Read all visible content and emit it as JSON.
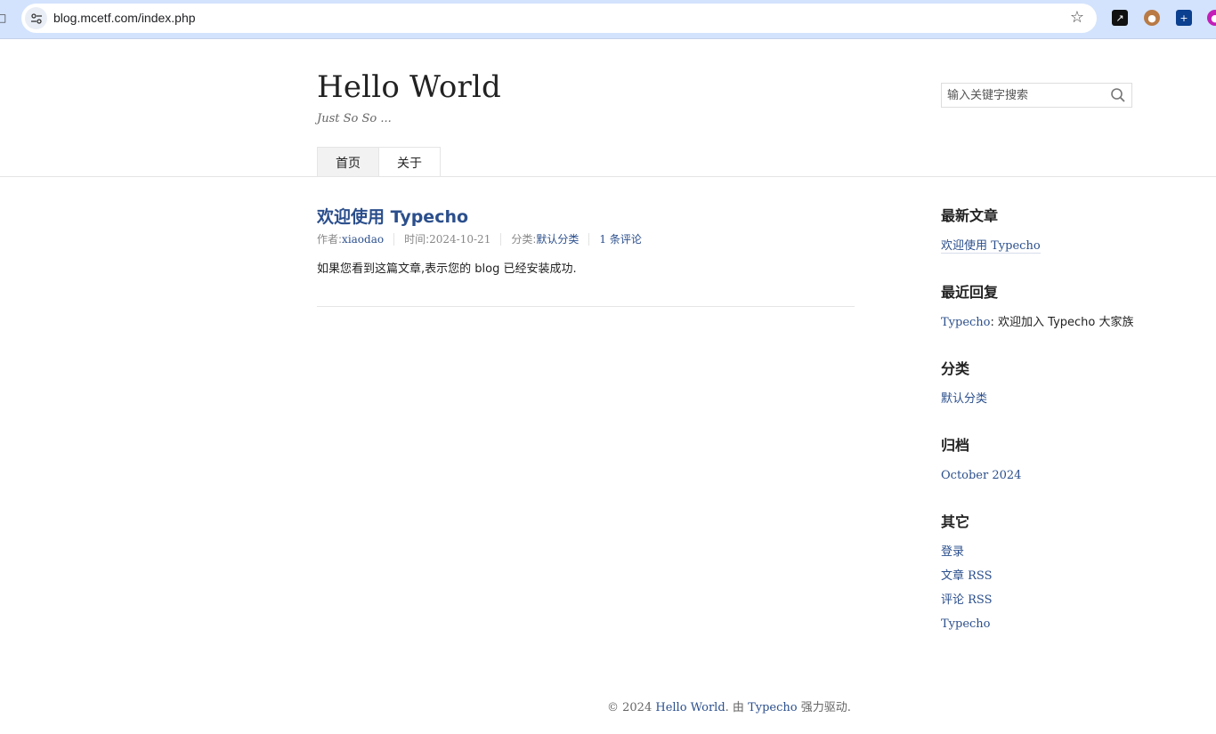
{
  "browser": {
    "url": "blog.mcetf.com/index.php"
  },
  "header": {
    "title": "Hello World",
    "description": "Just So So ...",
    "search_placeholder": "输入关键字搜索"
  },
  "nav": {
    "items": [
      {
        "label": "首页"
      },
      {
        "label": "关于"
      }
    ]
  },
  "post": {
    "title": "欢迎使用 Typecho",
    "author_label": "作者: ",
    "author": "xiaodao",
    "date_label": "时间: ",
    "date": "2024-10-21",
    "category_label": "分类: ",
    "category": "默认分类",
    "comments": "1 条评论",
    "body": "如果您看到这篇文章,表示您的 blog 已经安装成功."
  },
  "sidebar": {
    "recent_posts": {
      "title": "最新文章",
      "items": [
        "欢迎使用 Typecho"
      ]
    },
    "recent_comments": {
      "title": "最近回复",
      "author": "Typecho",
      "text": ": 欢迎加入 Typecho 大家族"
    },
    "categories": {
      "title": "分类",
      "items": [
        "默认分类"
      ]
    },
    "archives": {
      "title": "归档",
      "items": [
        "October 2024"
      ]
    },
    "other": {
      "title": "其它",
      "items": [
        "登录",
        "文章 RSS",
        "评论 RSS",
        "Typecho"
      ]
    }
  },
  "footer": {
    "prefix": "© 2024 ",
    "site": "Hello World",
    "middle": ". 由 ",
    "powered": "Typecho",
    "suffix": " 强力驱动."
  }
}
